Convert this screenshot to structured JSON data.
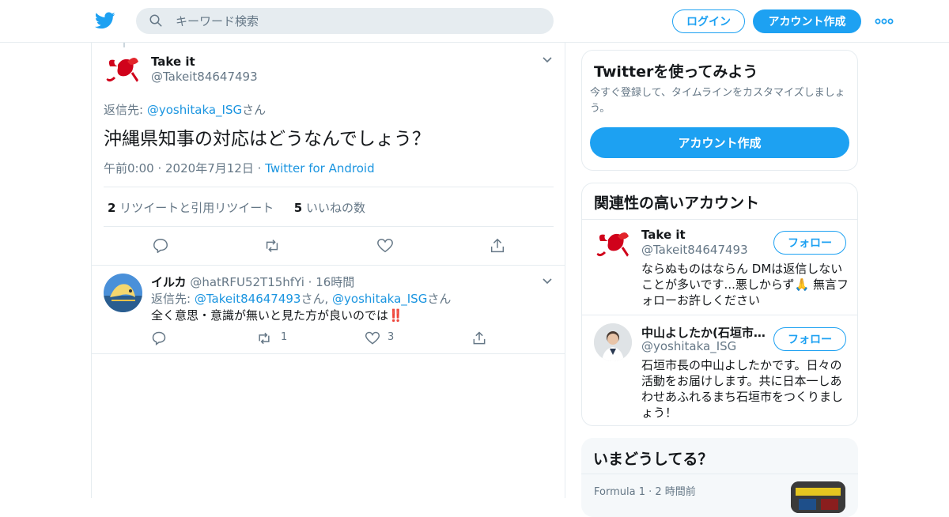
{
  "header": {
    "search_placeholder": "キーワード検索",
    "login_label": "ログイン",
    "signup_label": "アカウント作成"
  },
  "tweet": {
    "author_name": "Take it",
    "author_handle": "@Takeit84647493",
    "reply_prefix": "返信先: ",
    "reply_handle": "@yoshitaka_ISG",
    "reply_suffix": "さん",
    "text": "沖縄県知事の対応はどうなんでしょう？",
    "time": "午前0:00",
    "date": "2020年7月12日",
    "source": "Twitter for Android",
    "retweet_count": "2",
    "retweet_label": "リツイートと引用リツイート",
    "like_count": "5",
    "like_label": "いいねの数"
  },
  "reply": {
    "author_name": "イルカ",
    "author_handle": "@hatRFU52T15hfYi",
    "age": "16時間",
    "reply_prefix": "返信先: ",
    "reply_handle_1": "@Takeit84647493",
    "reply_mid": "さん, ",
    "reply_handle_2": "@yoshitaka_ISG",
    "reply_suffix": "さん",
    "text": "全く意思・意識が無いと見た方が良いのでは",
    "emoji": "‼️",
    "retweets": "1",
    "likes": "3"
  },
  "signup_card": {
    "title": "Twitterを使ってみよう",
    "description": "今すぐ登録して、タイムラインをカスタマイズしましょう。",
    "cta": "アカウント作成"
  },
  "related": {
    "title": "関連性の高いアカウント",
    "follow_label": "フォロー",
    "accounts": [
      {
        "name": "Take it",
        "handle": "@Takeit84647493",
        "bio": "ならぬものはならん DMは返信しないことが多いです...悪しからず🙏 無言フォローお許しください"
      },
      {
        "name": "中山よしたか(石垣市…",
        "handle": "@yoshitaka_ISG",
        "bio": "石垣市長の中山よしたかです。日々の活動をお届けします。共に日本一しあわせあふれるまち石垣市をつくりましょう！"
      }
    ]
  },
  "trends": {
    "title": "いまどうしてる？",
    "item_category": "Formula 1",
    "item_age": "2 時間前"
  },
  "colors": {
    "brand": "#1da1f2",
    "link": "#1b95e0",
    "muted": "#657786",
    "border": "#e6ecf0"
  }
}
